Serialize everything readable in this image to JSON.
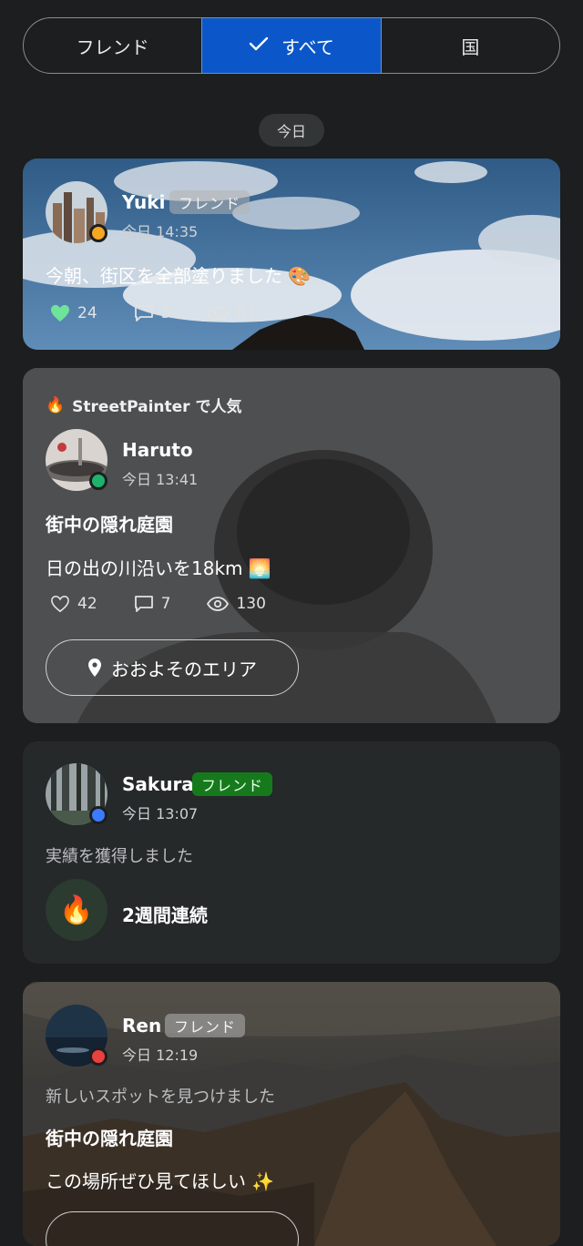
{
  "segments": [
    {
      "label": "フレンド",
      "active": false
    },
    {
      "label": "すべて",
      "active": true
    },
    {
      "label": "国",
      "active": false
    }
  ],
  "date_chip": "今日",
  "posts": [
    {
      "user": "Yuki",
      "badge": "フレンド",
      "time": "今日 14:35",
      "text": "今朝、街区を全部塗りました 🎨",
      "likes": "24",
      "comments": "3",
      "views": "61",
      "status_color": "#f5a623",
      "liked": true
    },
    {
      "popular_label": "StreetPainter で人気",
      "user": "Haruto",
      "time": "今日 13:41",
      "title": "街中の隠れ庭園",
      "text": "日の出の川沿いを18km 🌅",
      "likes": "42",
      "comments": "7",
      "views": "130",
      "area_button": "おおよそのエリア",
      "status_color": "#1db36a"
    },
    {
      "user": "Sakura",
      "badge": "フレンド",
      "time": "今日 13:07",
      "subtitle": "実績を獲得しました",
      "achievement": "2週間連続",
      "status_color": "#3b7bff"
    },
    {
      "user": "Ren",
      "badge": "フレンド",
      "time": "今日 12:19",
      "subtitle": "新しいスポットを見つけました",
      "title": "街中の隠れ庭園",
      "text": "この場所ぜひ見てほしい ✨",
      "status_color": "#e94040"
    }
  ]
}
